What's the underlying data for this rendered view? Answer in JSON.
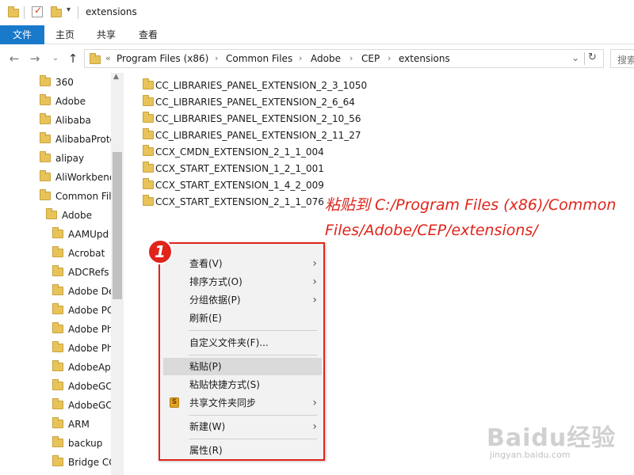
{
  "window": {
    "title": "extensions"
  },
  "ribbon": {
    "tabs": [
      {
        "label": "文件",
        "active": true
      },
      {
        "label": "主页",
        "active": false
      },
      {
        "label": "共享",
        "active": false
      },
      {
        "label": "查看",
        "active": false
      }
    ]
  },
  "address": {
    "prefix": "«",
    "crumbs": [
      "Program Files (x86)",
      "Common Files",
      "Adobe",
      "CEP",
      "extensions"
    ],
    "search_placeholder": "搜索"
  },
  "nav_pane": {
    "items": [
      {
        "label": "360"
      },
      {
        "label": "Adobe"
      },
      {
        "label": "Alibaba"
      },
      {
        "label": "AlibabaProte"
      },
      {
        "label": "alipay"
      },
      {
        "label": "AliWorkbenc"
      },
      {
        "label": "Common Fil"
      },
      {
        "label": "Adobe"
      },
      {
        "label": "AAMUpd"
      },
      {
        "label": "Acrobat"
      },
      {
        "label": "ADCRefs"
      },
      {
        "label": "Adobe De"
      },
      {
        "label": "Adobe PC"
      },
      {
        "label": "Adobe Ph"
      },
      {
        "label": "Adobe Ph"
      },
      {
        "label": "AdobeAp"
      },
      {
        "label": "AdobeGC"
      },
      {
        "label": "AdobeGC"
      },
      {
        "label": "ARM"
      },
      {
        "label": "backup"
      },
      {
        "label": "Bridge CC"
      }
    ]
  },
  "files": [
    "CC_LIBRARIES_PANEL_EXTENSION_2_3_1050",
    "CC_LIBRARIES_PANEL_EXTENSION_2_6_64",
    "CC_LIBRARIES_PANEL_EXTENSION_2_10_56",
    "CC_LIBRARIES_PANEL_EXTENSION_2_11_27",
    "CCX_CMDN_EXTENSION_2_1_1_004",
    "CCX_START_EXTENSION_1_2_1_001",
    "CCX_START_EXTENSION_1_4_2_009",
    "CCX_START_EXTENSION_2_1_1_076"
  ],
  "annotation": {
    "line1": "粘贴到 C:/Program Files (x86)/Common",
    "line2": "Files/Adobe/CEP/extensions/",
    "step_number": "1",
    "color": "#e0241b"
  },
  "context_menu": {
    "items": [
      {
        "label": "查看(V)",
        "submenu": true
      },
      {
        "label": "排序方式(O)",
        "submenu": true
      },
      {
        "label": "分组依据(P)",
        "submenu": true
      },
      {
        "label": "刷新(E)",
        "submenu": false
      },
      {
        "label": "自定义文件夹(F)...",
        "submenu": false
      },
      {
        "label": "粘贴(P)",
        "submenu": false,
        "highlighted": true
      },
      {
        "label": "粘贴快捷方式(S)",
        "submenu": false
      },
      {
        "label": "共享文件夹同步",
        "submenu": true
      },
      {
        "label": "新建(W)",
        "submenu": true
      },
      {
        "label": "属性(R)",
        "submenu": false
      }
    ]
  },
  "watermark": {
    "brand": "Baidu经验",
    "url": "jingyan.baidu.com"
  }
}
